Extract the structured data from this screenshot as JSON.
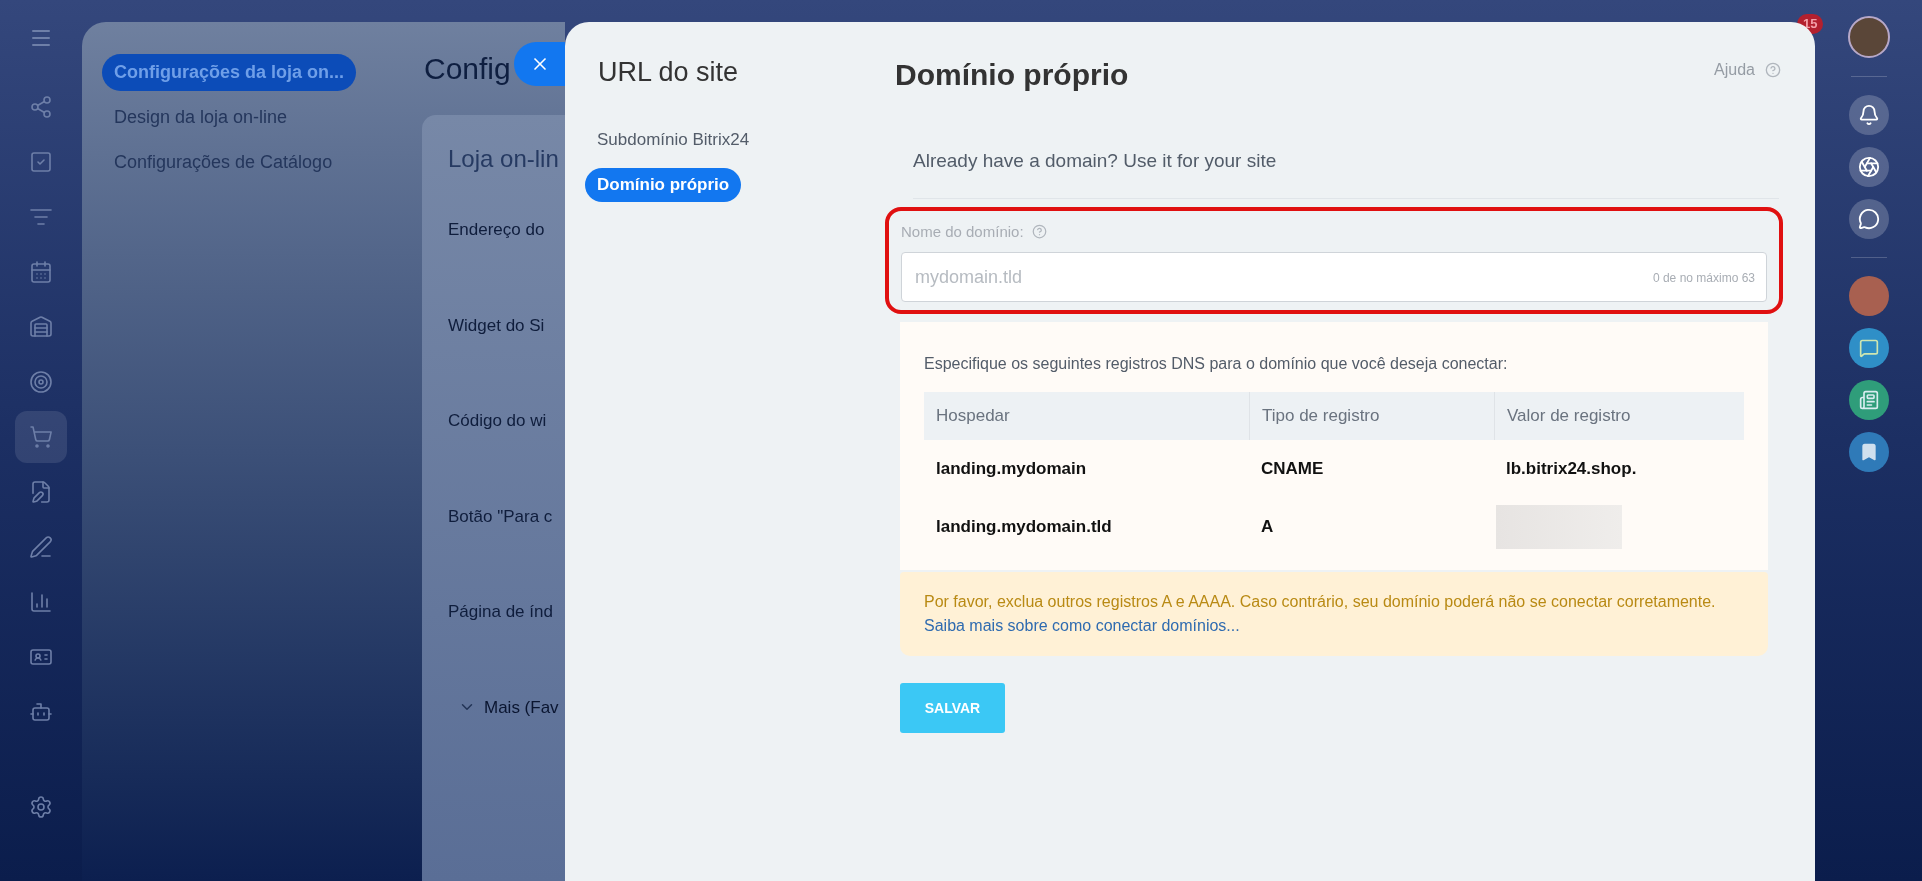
{
  "background_page": {
    "menu": [
      {
        "label": "Configurações da loja on...",
        "selected": true
      },
      {
        "label": "Design da loja on-line",
        "selected": false
      },
      {
        "label": "Configurações de Catálogo",
        "selected": false
      }
    ],
    "title": "Config",
    "card_title": "Loja on-lin",
    "fields": [
      {
        "label": "Endereço do",
        "kind": "text"
      },
      {
        "label": "Widget do Si",
        "kind": "text"
      },
      {
        "label": "Código do wi",
        "kind": "text"
      },
      {
        "label": "Botão \"Para c",
        "kind": "text"
      },
      {
        "label": "Página de índ",
        "kind": "text"
      },
      {
        "label": "Mais (Fav",
        "kind": "expander"
      }
    ]
  },
  "notification_badge": "15",
  "modal": {
    "nav_title": "URL do site",
    "nav": [
      {
        "label": "Subdomínio Bitrix24",
        "selected": false
      },
      {
        "label": "Domínio próprio",
        "selected": true
      }
    ],
    "title": "Domínio próprio",
    "help": "Ajuda",
    "intro": "Already have a domain? Use it for your site",
    "domain_field": {
      "label": "Nome do domínio:",
      "placeholder": "mydomain.tld",
      "counter": "0 de no máximo 63"
    },
    "dns": {
      "instructions": "Especifique os seguintes registros DNS para o domínio que você deseja conectar:",
      "columns": [
        "Hospedar",
        "Tipo de registro",
        "Valor de registro"
      ],
      "rows": [
        {
          "host": "landing.mydomain",
          "type": "CNAME",
          "value": "lb.bitrix24.shop.",
          "redacted": false
        },
        {
          "host": "landing.mydomain.tld",
          "type": "A",
          "redacted": true
        }
      ]
    },
    "warning": {
      "text": "Por favor, exclua outros registros A e AAAA. Caso contrário, seu domínio poderá não se conectar corretamente.",
      "link": "Saiba mais sobre como conectar domínios..."
    },
    "save_button": "SALVAR"
  }
}
